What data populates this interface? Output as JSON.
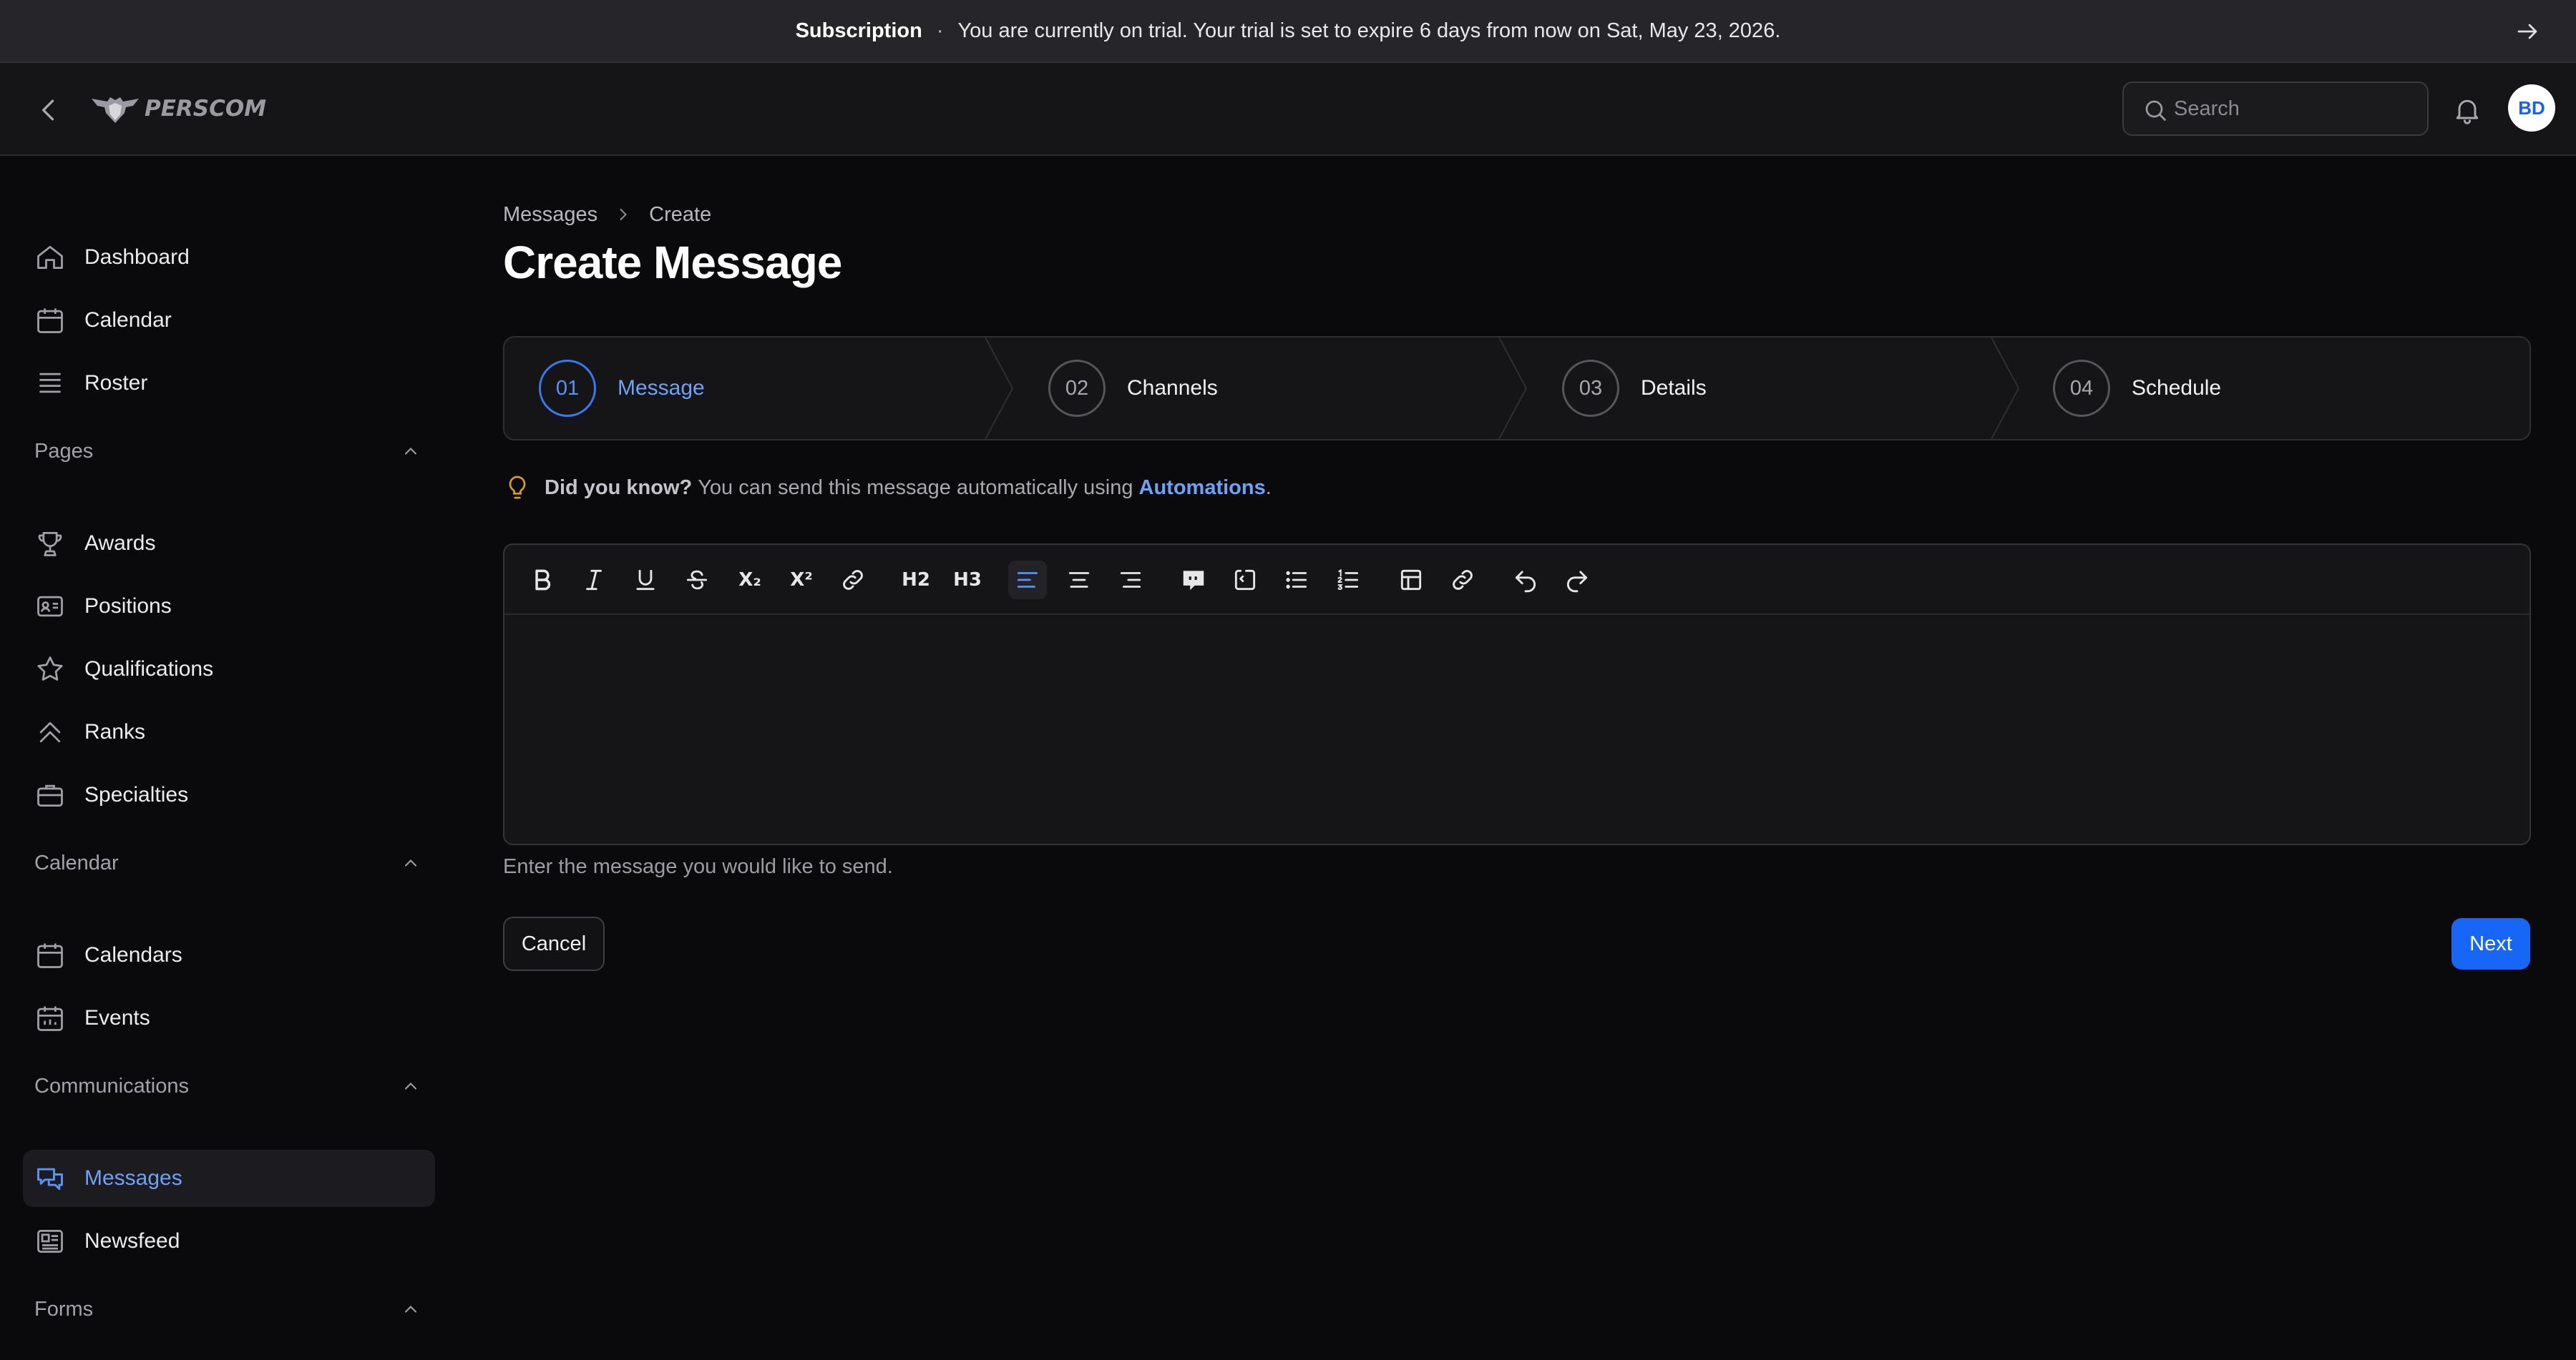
{
  "banner": {
    "title": "Subscription",
    "separator": "·",
    "message": "You are currently on trial. Your trial is set to expire 6 days from now on Sat, May 23, 2026."
  },
  "topbar": {
    "logo_text": "PERSCOM",
    "search_placeholder": "Search",
    "avatar_initials": "BD"
  },
  "sidebar": {
    "main_items": [
      {
        "label": "Dashboard",
        "icon": "home-icon"
      },
      {
        "label": "Calendar",
        "icon": "calendar-icon"
      },
      {
        "label": "Roster",
        "icon": "roster-icon"
      }
    ],
    "sections": [
      {
        "title": "Pages",
        "items": [
          {
            "label": "Awards",
            "icon": "trophy-icon"
          },
          {
            "label": "Positions",
            "icon": "id-card-icon"
          },
          {
            "label": "Qualifications",
            "icon": "star-icon"
          },
          {
            "label": "Ranks",
            "icon": "chevrons-up-icon"
          },
          {
            "label": "Specialties",
            "icon": "briefcase-icon"
          }
        ]
      },
      {
        "title": "Calendar",
        "items": [
          {
            "label": "Calendars",
            "icon": "calendar-icon"
          },
          {
            "label": "Events",
            "icon": "calendar-event-icon"
          }
        ]
      },
      {
        "title": "Communications",
        "items": [
          {
            "label": "Messages",
            "icon": "chat-bubbles-icon",
            "active": true
          },
          {
            "label": "Newsfeed",
            "icon": "newspaper-icon"
          }
        ]
      },
      {
        "title": "Forms",
        "items": []
      }
    ]
  },
  "breadcrumb": [
    "Messages",
    "Create"
  ],
  "page_title": "Create Message",
  "steps": [
    {
      "number": "01",
      "label": "Message",
      "active": true
    },
    {
      "number": "02",
      "label": "Channels",
      "active": false
    },
    {
      "number": "03",
      "label": "Details",
      "active": false
    },
    {
      "number": "04",
      "label": "Schedule",
      "active": false
    }
  ],
  "tip": {
    "lead": "Did you know?",
    "text": "You can send this message automatically using",
    "link": "Automations",
    "end": "."
  },
  "editor": {
    "toolbar": [
      "bold",
      "italic",
      "underline",
      "strikethrough",
      "subscript",
      "superscript",
      "link",
      "heading-2",
      "heading-3",
      "align-left",
      "align-center",
      "align-right",
      "blockquote",
      "code-block",
      "bullet-list",
      "ordered-list",
      "table",
      "attach-link",
      "undo",
      "redo"
    ],
    "toolbar_text": {
      "subscript": "X₂",
      "superscript": "X²",
      "h2": "H2",
      "h3": "H3"
    },
    "active_tool": "align-left",
    "value": ""
  },
  "helper_text": "Enter the message you would like to send.",
  "actions": {
    "cancel": "Cancel",
    "next": "Next"
  },
  "colors": {
    "accent": "#1766f6",
    "accent_text": "#6ea2f6",
    "background": "#0a0a0c",
    "tip_icon": "#d99a2b"
  }
}
